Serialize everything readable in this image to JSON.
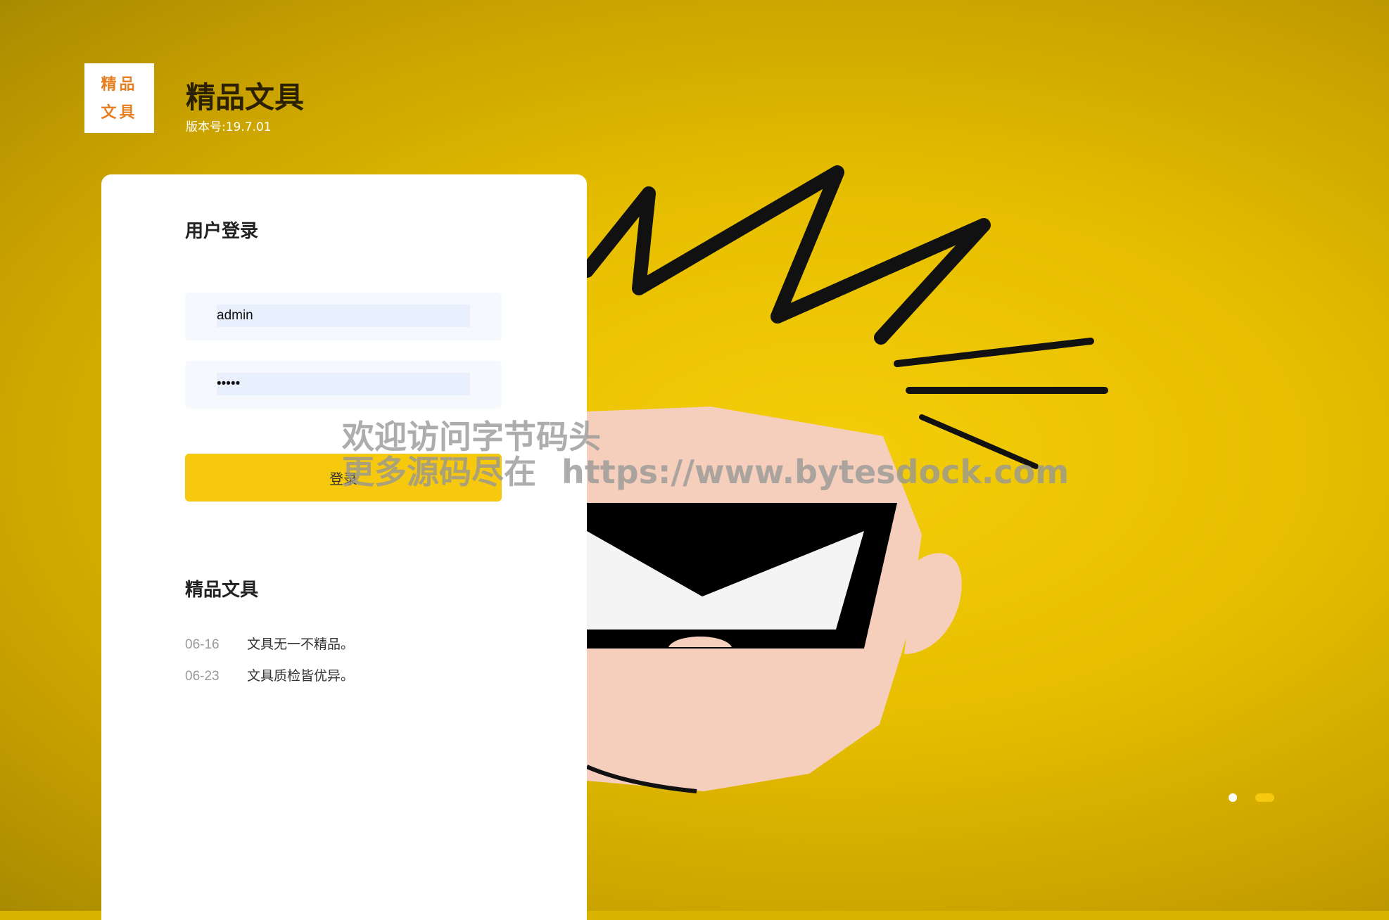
{
  "brand": {
    "logo_line1": "精品",
    "logo_line2": "文具",
    "title": "精品文具",
    "version": "版本号:19.7.01"
  },
  "login": {
    "heading": "用户登录",
    "username_value": "admin",
    "password_value": "•••••",
    "submit_label": "登录"
  },
  "news": {
    "heading": "精品文具",
    "items": [
      {
        "date": "06-16",
        "text": "文具无一不精品。"
      },
      {
        "date": "06-23",
        "text": "文具质检皆优异。"
      }
    ]
  },
  "watermark": {
    "line1": "欢迎访问字节码头",
    "line2_prefix": "更多源码尽在",
    "line2_url": "https://www.bytesdock.com"
  },
  "carousel": {
    "slide_count": 2,
    "active_index": 2
  },
  "colors": {
    "accent": "#f6c90e",
    "logo_text": "#e67e22",
    "panel": "#ffffff"
  }
}
